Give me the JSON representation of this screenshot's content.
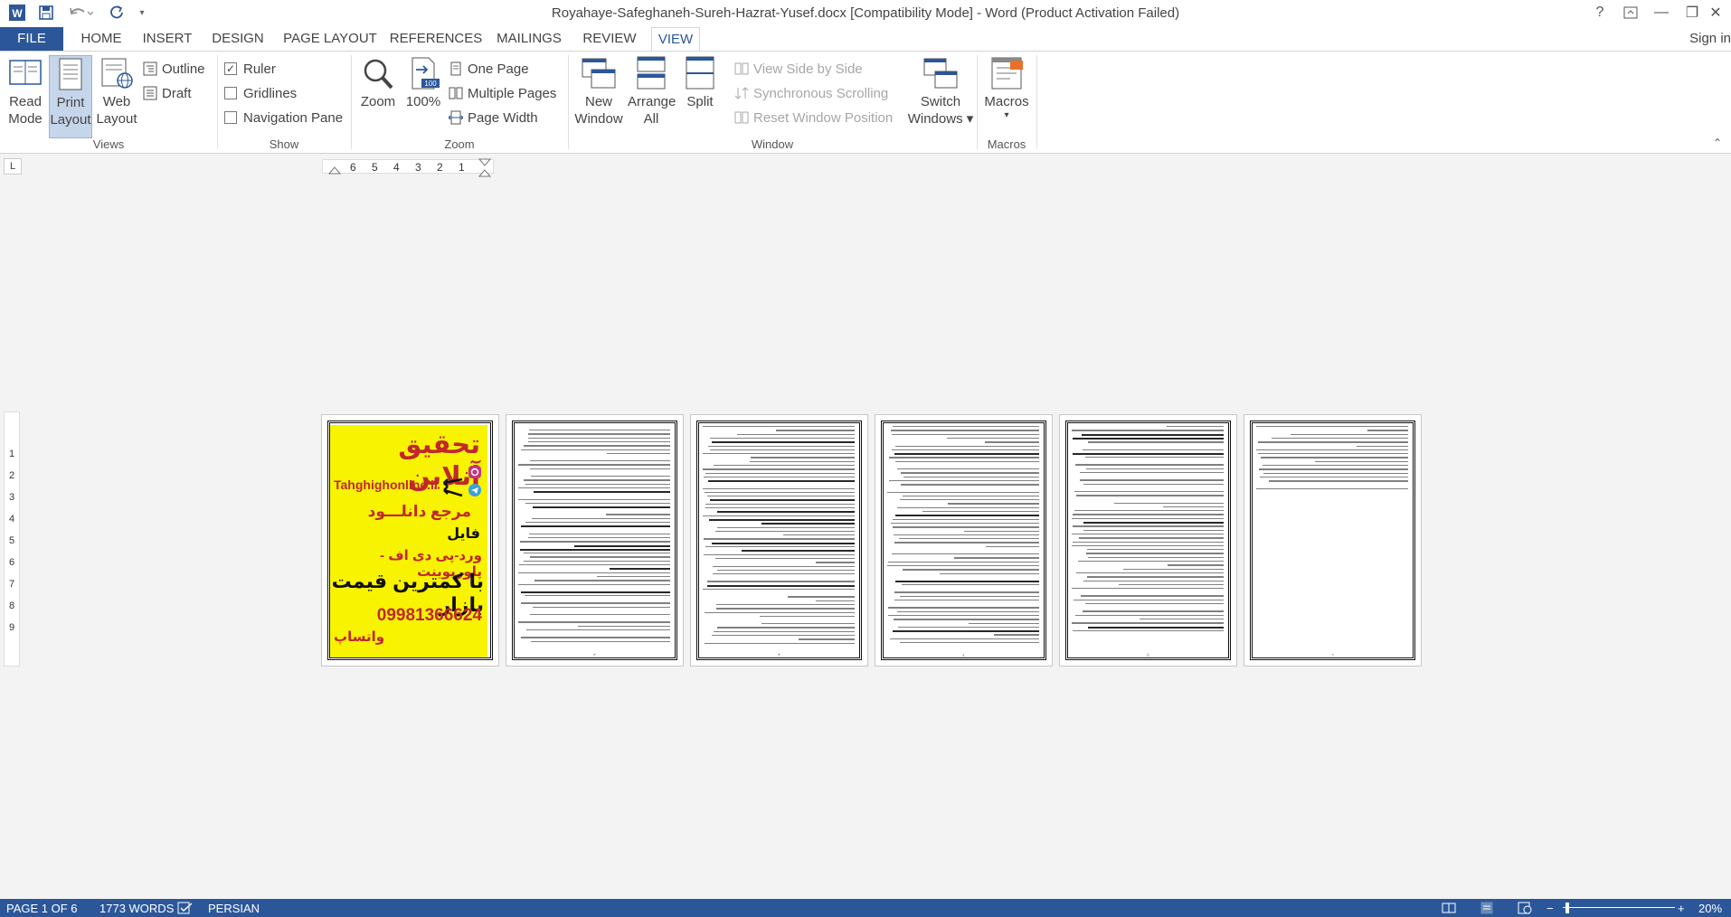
{
  "window": {
    "title": "Royahaye-Safeghaneh-Sureh-Hazrat-Yusef.docx [Compatibility Mode] - Word (Product Activation Failed)",
    "help": "?",
    "minimize": "—",
    "restore": "❐",
    "close": "✕"
  },
  "tabs": [
    "FILE",
    "HOME",
    "INSERT",
    "DESIGN",
    "PAGE LAYOUT",
    "REFERENCES",
    "MAILINGS",
    "REVIEW",
    "VIEW"
  ],
  "signin": "Sign in",
  "ribbon": {
    "views": {
      "label": "Views",
      "read_mode": [
        "Read",
        "Mode"
      ],
      "print_layout": [
        "Print",
        "Layout"
      ],
      "web_layout": [
        "Web",
        "Layout"
      ],
      "outline": "Outline",
      "draft": "Draft"
    },
    "show": {
      "label": "Show",
      "ruler": "Ruler",
      "ruler_checked": true,
      "gridlines": "Gridlines",
      "navigation_pane": "Navigation Pane"
    },
    "zoom": {
      "label": "Zoom",
      "zoom": "Zoom",
      "hundred": "100%",
      "one_page": "One Page",
      "multiple_pages": "Multiple Pages",
      "page_width": "Page Width"
    },
    "window": {
      "label": "Window",
      "new_window": [
        "New",
        "Window"
      ],
      "arrange_all": [
        "Arrange",
        "All"
      ],
      "split": "Split",
      "view_side_by_side": "View Side by Side",
      "sync_scrolling": "Synchronous Scrolling",
      "reset_position": "Reset Window Position",
      "switch_windows": [
        "Switch",
        "Windows ▾"
      ]
    },
    "macros": {
      "label": "Macros",
      "macros": [
        "Macros",
        "▾"
      ]
    }
  },
  "ruler": {
    "corner": "L",
    "h_ticks": [
      "6",
      "5",
      "4",
      "3",
      "2",
      "1"
    ],
    "v_ticks": [
      "1",
      "2",
      "3",
      "4",
      "5",
      "6",
      "7",
      "8",
      "9"
    ]
  },
  "ad": {
    "title": "تحقیق آنلاین",
    "site": "Tahghighonline.ir",
    "ref": "مرجع دانلـــود",
    "file": "فایل",
    "formats": "ورد-پی دی اف - پاورپوینت",
    "price": "با کمترین قیمت بازار",
    "phone": "09981366624",
    "whatsapp": "واتساپ"
  },
  "status": {
    "page": "PAGE 1 OF 6",
    "words": "1773 WORDS",
    "language": "PERSIAN",
    "zoom": "20%"
  }
}
